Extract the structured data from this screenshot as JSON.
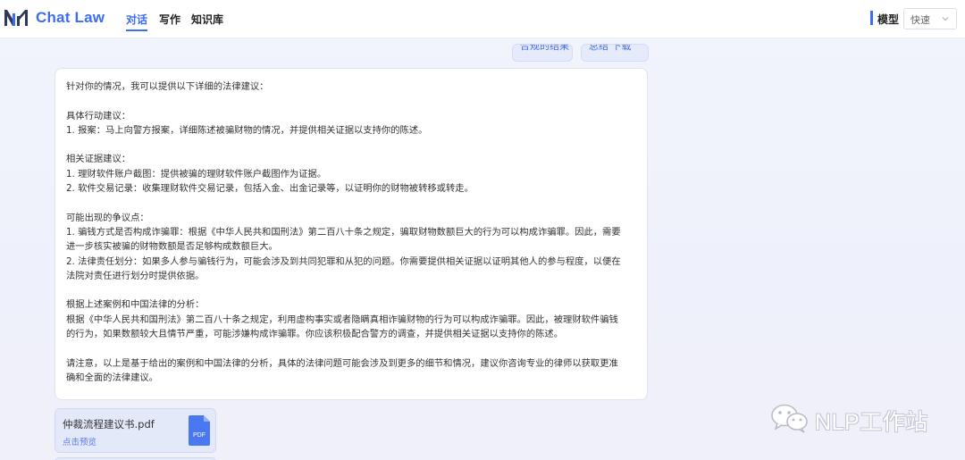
{
  "app": {
    "brand": "Chat Law",
    "brand_color": "#3d6cf5"
  },
  "nav": {
    "tabs": [
      {
        "label": "对话",
        "active": true
      },
      {
        "label": "写作",
        "active": false
      },
      {
        "label": "知识库",
        "active": false
      }
    ]
  },
  "model": {
    "label": "模型",
    "selected": "快速"
  },
  "pills": [
    {
      "label": "合规的结果"
    },
    {
      "label": "总结 下载"
    }
  ],
  "answer": {
    "lines": [
      "针对你的情况，我可以提供以下详细的法律建议：",
      "",
      "具体行动建议：",
      "1. 报案：马上向警方报案，详细陈述被骗财物的情况，并提供相关证据以支持你的陈述。",
      "",
      "相关证据建议：",
      "1. 理财软件账户截图：提供被骗的理财软件账户截图作为证据。",
      "2. 软件交易记录：收集理财软件交易记录，包括入金、出金记录等，以证明你的财物被转移或转走。",
      "",
      "可能出现的争议点：",
      "1. 骗钱方式是否构成诈骗罪：根据《中华人民共和国刑法》第二百八十条之规定，骗取财物数额巨大的行为可以构成诈骗罪。因此，需要",
      "进一步核实被骗的财物数额是否足够构成数额巨大。",
      "2. 法律责任划分：如果多人参与骗钱行为，可能会涉及到共同犯罪和从犯的问题。你需要提供相关证据以证明其他人的参与程度，以便在",
      "法院对责任进行划分时提供依据。",
      "",
      "根据上述案例和中国法律的分析：",
      "根据《中华人民共和国刑法》第二百八十条之规定，利用虚构事实或者隐瞒真相诈骗财物的行为可以构成诈骗罪。因此，被理财软件骗钱",
      "的行为，如果数额较大且情节严重，可能涉嫌构成诈骗罪。你应该积极配合警方的调查，并提供相关证据以支持你的陈述。",
      "",
      "请注意，以上是基于给出的案例和中国法律的分析，具体的法律问题可能会涉及到更多的细节和情况，建议你咨询专业的律师以获取更准",
      "确和全面的法律建议。"
    ]
  },
  "file": {
    "name": "仲裁流程建议书.pdf",
    "action": "点击预览",
    "icon_label": "PDF",
    "icon_color": "#4a78f0"
  },
  "watermark": {
    "text": "NLP工作站"
  }
}
